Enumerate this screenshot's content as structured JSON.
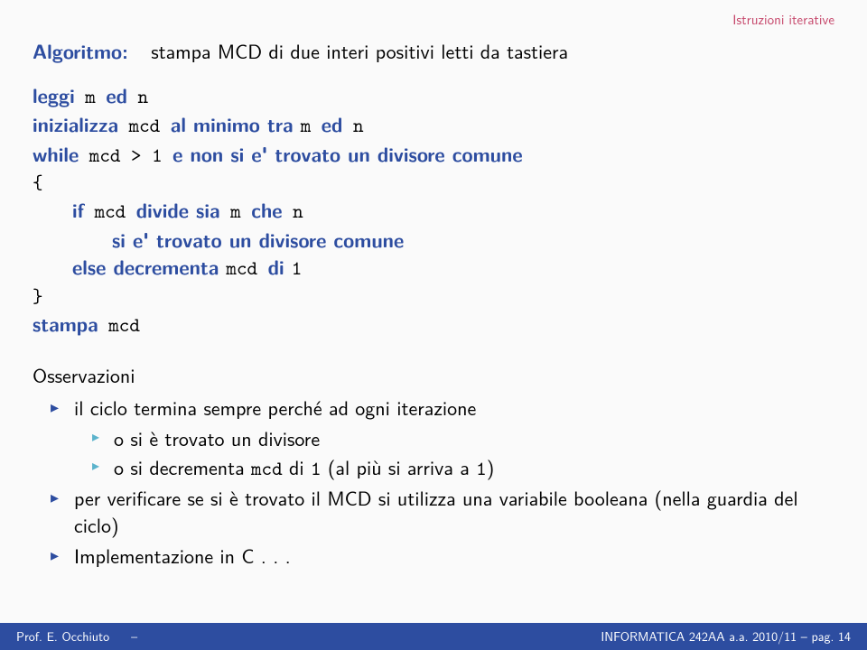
{
  "header": {
    "label": "Istruzioni iterative"
  },
  "title": {
    "label": "Algoritmo:",
    "text": "stampa MCD di due interi positivi letti da tastiera"
  },
  "pseudo": {
    "l1a": "leggi",
    "l1b": " m ",
    "l1c": "ed",
    "l1d": " n",
    "l2a": "inizializza",
    "l2b": " mcd ",
    "l2c": "al minimo tra ",
    "l2d": "m ",
    "l2e": "ed",
    "l2f": " n",
    "l3a": "while",
    "l3b": " mcd > 1 ",
    "l3c": "e non si e' trovato un divisore comune",
    "l4": "{",
    "l5a": "if",
    "l5b": " mcd ",
    "l5c": "divide sia",
    "l5d": " m ",
    "l5e": "che",
    "l5f": " n",
    "l6": "si e' trovato un divisore comune",
    "l7a": "else",
    "l7b": " decrementa ",
    "l7c": "mcd ",
    "l7d": "di ",
    "l7e": "1",
    "l8": "}",
    "l9a": "stampa",
    "l9b": " mcd"
  },
  "obs": {
    "title": "Osservazioni",
    "b1": "il ciclo termina sempre perché ad ogni iterazione",
    "b1a": "o si è trovato un divisore",
    "b1b_pre": "o si decrementa ",
    "b1b_mcd": "mcd",
    "b1b_mid": " di ",
    "b1b_one": "1",
    "b1b_post": " (al più si arriva a ",
    "b1b_one2": "1",
    "b1b_end": ")",
    "b2": "per verificare se si è trovato il MCD si utilizza una variabile booleana (nella guardia del ciclo)",
    "b3": "Implementazione in C . . ."
  },
  "footer": {
    "author": "Prof. E. Occhiuto",
    "dash": "–",
    "course": "INFORMATICA 242AA a.a. 2010/11  –  pag. 14"
  }
}
